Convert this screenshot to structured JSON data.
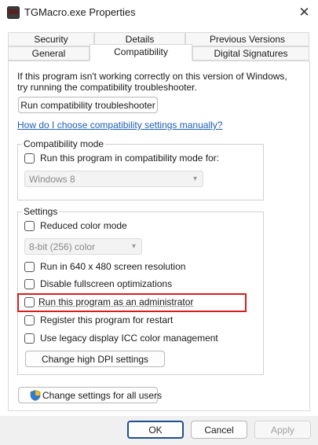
{
  "window": {
    "title": "TGMacro.exe Properties",
    "app_icon_text": "TGM"
  },
  "tabs": {
    "row_top": [
      {
        "label": "Security"
      },
      {
        "label": "Details"
      },
      {
        "label": "Previous Versions"
      }
    ],
    "row_bottom": [
      {
        "label": "General"
      },
      {
        "label": "Compatibility",
        "active": true
      },
      {
        "label": "Digital Signatures"
      }
    ]
  },
  "compat": {
    "intro_line1": "If this program isn't working correctly on this version of Windows,",
    "intro_line2": "try running the compatibility troubleshooter.",
    "troubleshooter_button": "Run compatibility troubleshooter",
    "help_link": "How do I choose compatibility settings manually?",
    "mode_group": {
      "title": "Compatibility mode",
      "checkbox_label": "Run this program in compatibility mode for:",
      "checked": false,
      "os_select_value": "Windows 8"
    },
    "settings_group": {
      "title": "Settings",
      "reduced_color": {
        "label": "Reduced color mode",
        "checked": false
      },
      "color_select_value": "8-bit (256) color",
      "run_640": {
        "label": "Run in 640 x 480 screen resolution",
        "checked": false
      },
      "disable_fullscreen": {
        "label": "Disable fullscreen optimizations",
        "checked": false
      },
      "run_admin": {
        "label": "Run this program as an administrator",
        "checked": false
      },
      "register_restart": {
        "label": "Register this program for restart",
        "checked": false
      },
      "legacy_icc": {
        "label": "Use legacy display ICC color management",
        "checked": false
      },
      "dpi_button": "Change high DPI settings"
    },
    "all_users_button": "Change settings for all users"
  },
  "footer": {
    "ok": "OK",
    "cancel": "Cancel",
    "apply": "Apply"
  },
  "colors": {
    "highlight": "#d91d1d",
    "link": "#1d5fb3",
    "primary_border": "#1f4e8c"
  }
}
